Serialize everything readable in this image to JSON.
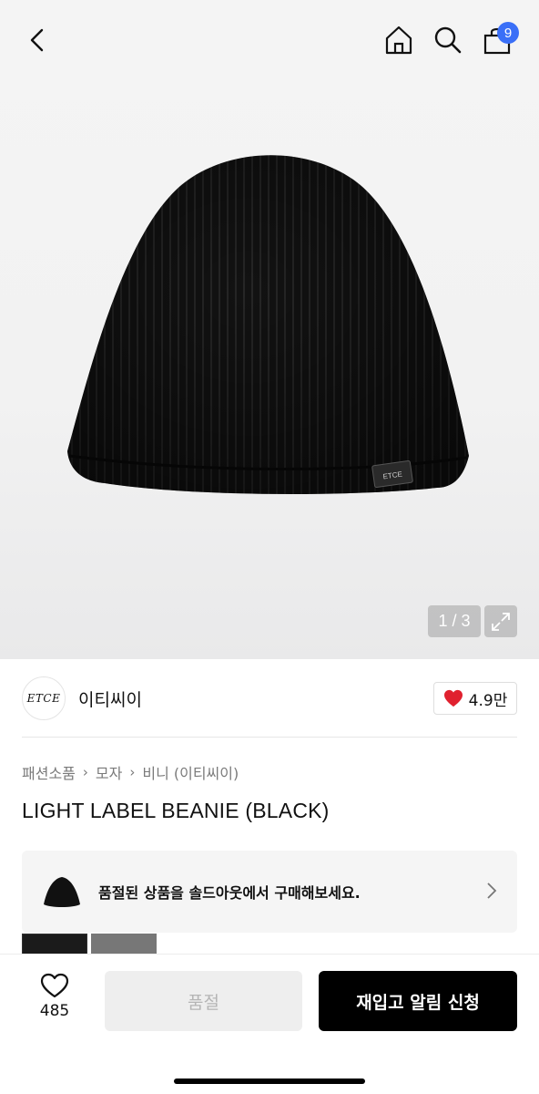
{
  "header": {
    "cart_count": "9"
  },
  "gallery": {
    "pager": "1 / 3",
    "label_text": "ETCE"
  },
  "brand": {
    "logo_text": "ETCE",
    "name": "이티씨이",
    "like_count": "4.9만"
  },
  "breadcrumb": [
    "패션소품",
    "모자",
    "비니 (이티씨이)"
  ],
  "product": {
    "title": "LIGHT LABEL BEANIE (BLACK)"
  },
  "soldout_banner": {
    "text": "품절된 상품을 솔드아웃에서 구매해보세요."
  },
  "bottom_bar": {
    "wish_count": "485",
    "soldout_label": "품절",
    "restock_label": "재입고 알림 신청"
  },
  "colors": {
    "badge": "#3a6ff7",
    "heart": "#e0212f",
    "primary_button": "#000000",
    "disabled_button": "#eeeeee"
  },
  "icons": [
    "back-arrow-icon",
    "home-icon",
    "search-icon",
    "shopping-bag-icon",
    "expand-icon",
    "heart-icon",
    "chevron-right-icon"
  ]
}
